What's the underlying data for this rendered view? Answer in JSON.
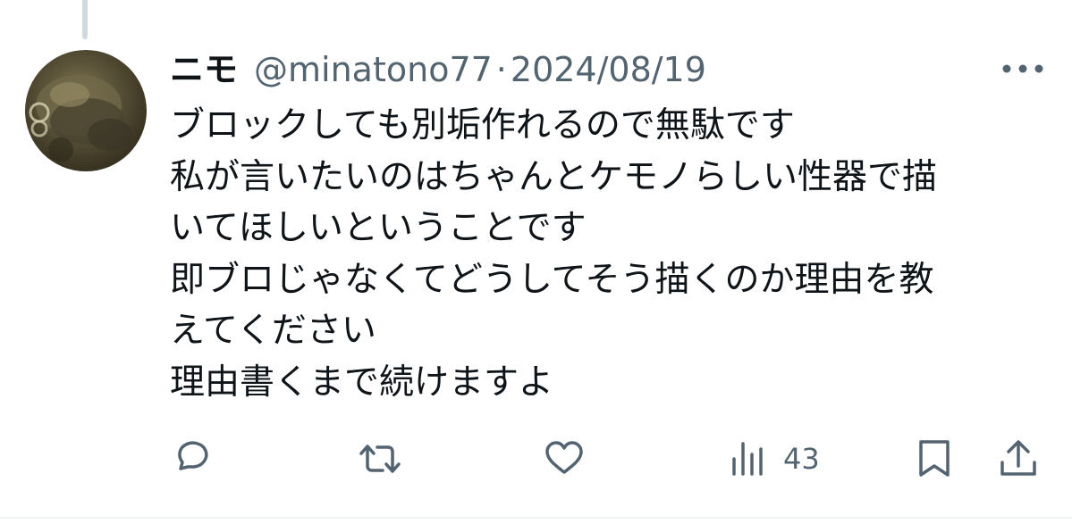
{
  "tweet": {
    "display_name": "ニモ",
    "handle": "@minatono77",
    "separator": "·",
    "date": "2024/08/19",
    "lines": [
      "ブロックしても別垢作れるので無駄です",
      "私が言いたいのはちゃんとケモノらしい性器で描",
      "いてほしいということです",
      "即ブロじゃなくてどうしてそう描くのか理由を教",
      "えてください",
      "理由書くまで続けますよ"
    ]
  },
  "actions": {
    "views_count": "43"
  },
  "icons": {
    "more": "more-dots-icon",
    "reply": "reply-icon",
    "retweet": "retweet-icon",
    "like": "heart-icon",
    "views": "views-icon",
    "bookmark": "bookmark-icon",
    "share": "share-icon"
  },
  "colors": {
    "text_primary": "#0f1419",
    "text_secondary": "#536471",
    "thread_line": "#cfd9de",
    "divider": "#eff3f4"
  }
}
